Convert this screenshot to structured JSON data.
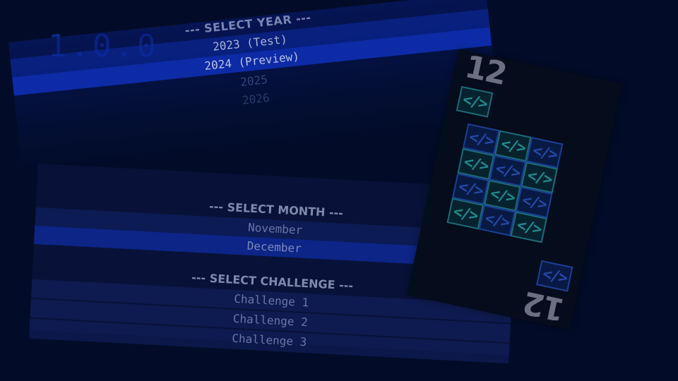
{
  "version": "1.0.0",
  "year_menu": {
    "title": "--- SELECT YEAR ---",
    "items": [
      "2023 (Test)",
      "2024 (Preview)",
      "2025",
      "2026"
    ]
  },
  "month_menu": {
    "title": "--- SELECT MONTH ---",
    "items": [
      "November",
      "December"
    ]
  },
  "challenge_menu": {
    "title": "--- SELECT CHALLENGE ---",
    "items": [
      "Challenge 1",
      "Challenge 2",
      "Challenge 3"
    ]
  },
  "card": {
    "rank": "12",
    "pip_glyph": "</>",
    "colors": {
      "teal": "#1f8a8e",
      "blue": "#2348a8",
      "face": "#050c1c"
    }
  },
  "colors": {
    "background": "#020c28",
    "highlight": "#1034c8",
    "version_text": "#0b2a8c"
  }
}
